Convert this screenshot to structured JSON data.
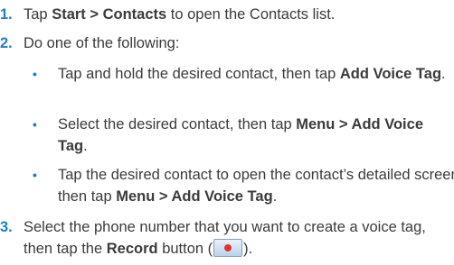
{
  "steps": [
    {
      "number": "1.",
      "pre": "Tap ",
      "bold": "Start > Contacts",
      "post": " to open the Contacts list."
    },
    {
      "number": "2.",
      "text": "Do one of the following:",
      "bullets": [
        {
          "pre": "Tap and hold the desired contact, then tap ",
          "bold": "Add Voice Tag",
          "post": "."
        },
        {
          "pre": "Select the desired contact, then tap ",
          "bold": "Menu > Add Voice Tag",
          "post": "."
        },
        {
          "pre": "Tap the desired contact to open the contact’s detailed screen, then tap ",
          "bold": "Menu > Add Voice Tag",
          "post": "."
        }
      ]
    },
    {
      "number": "3.",
      "pre": "Select the phone number that you want to create a voice tag, then tap the ",
      "bold": "Record",
      "post_before_icon": " button (",
      "post_after_icon": ")."
    }
  ],
  "bullet_glyph": "•",
  "icons": {
    "record_button": "record-button-icon"
  },
  "colors": {
    "accent": "#1f7fc3",
    "text": "#3b3b3b",
    "record_dot": "#e0342b"
  }
}
